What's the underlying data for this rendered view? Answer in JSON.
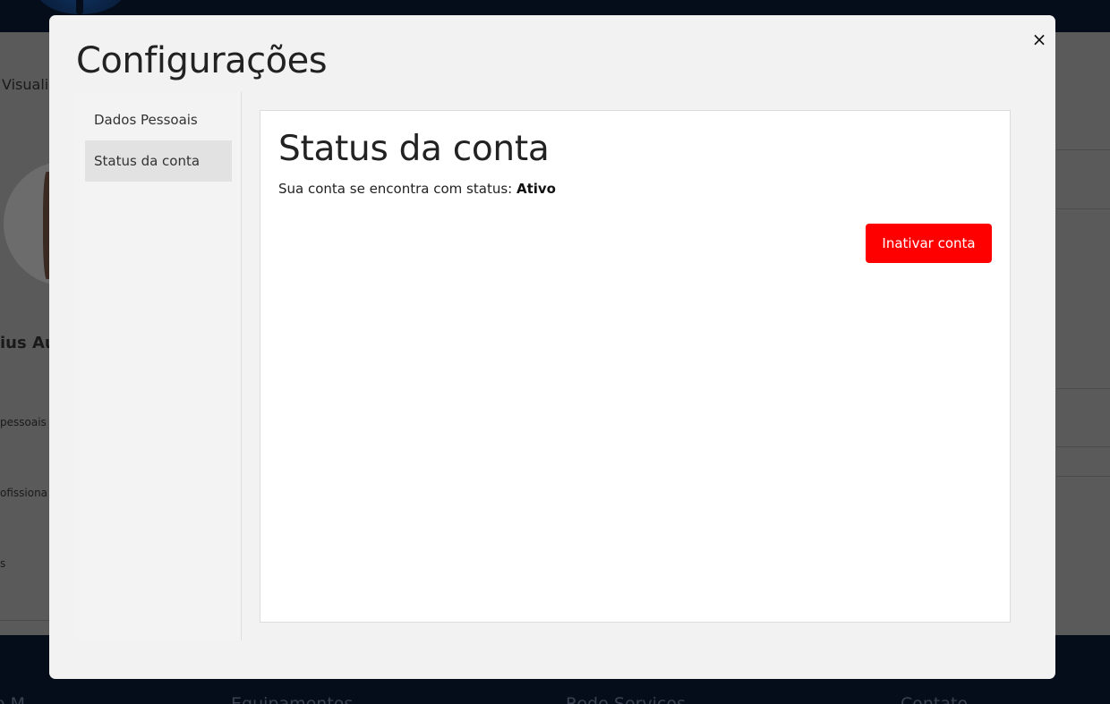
{
  "background": {
    "header_fragment": "Visuali",
    "name_fragment": "ius Au",
    "menu_fragments": [
      "pessoais",
      "ofissiona",
      "s"
    ],
    "footer_fragments": [
      "o M",
      "Equipamentos",
      "Rede Serviços",
      "Contato"
    ]
  },
  "modal": {
    "title": "Configurações",
    "close_label": "×",
    "nav": [
      {
        "label": "Dados Pessoais",
        "active": false
      },
      {
        "label": "Status da conta",
        "active": true
      }
    ],
    "content": {
      "heading": "Status da conta",
      "status_prefix": "Sua conta se encontra com status:",
      "status_value": "Ativo",
      "deactivate_label": "Inativar conta"
    }
  },
  "colors": {
    "danger": "#ff0000",
    "overlay": "#555555",
    "modal_bg": "#f2f2f2",
    "nav_active": "#e2e2e2",
    "header_footer": "#050c1a"
  },
  "icons": {
    "close": "close-icon"
  }
}
